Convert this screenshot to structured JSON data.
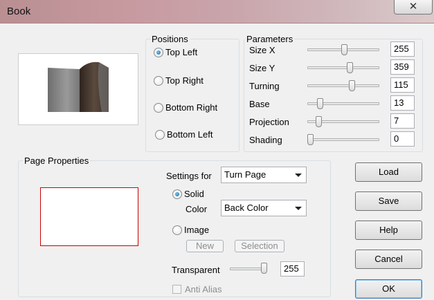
{
  "window": {
    "title": "Book",
    "close_glyph": "✕"
  },
  "positions": {
    "legend": "Positions",
    "options": [
      {
        "label": "Top Left",
        "checked": true
      },
      {
        "label": "Top Right",
        "checked": false
      },
      {
        "label": "Bottom Right",
        "checked": false
      },
      {
        "label": "Bottom Left",
        "checked": false
      }
    ]
  },
  "parameters": {
    "legend": "Parameters",
    "rows": [
      {
        "label": "Size X",
        "value": "255",
        "level": 0.52
      },
      {
        "label": "Size Y",
        "value": "359",
        "level": 0.6
      },
      {
        "label": "Turning",
        "value": "115",
        "level": 0.63
      },
      {
        "label": "Base",
        "value": "13",
        "level": 0.15
      },
      {
        "label": "Projection",
        "value": "7",
        "level": 0.13
      },
      {
        "label": "Shading",
        "value": "0",
        "level": 0.0
      }
    ]
  },
  "page_properties": {
    "legend": "Page Properties",
    "settings_for_label": "Settings for",
    "settings_for_value": "Turn Page",
    "solid_label": "Solid",
    "color_label": "Color",
    "color_value": "Back Color",
    "image_label": "Image",
    "new_label": "New",
    "selection_label": "Selection",
    "transparent_label": "Transparent",
    "transparent_value": "255",
    "transparent_level": 1.0,
    "anti_alias_label": "Anti Alias"
  },
  "buttons": {
    "load": "Load",
    "save": "Save",
    "help": "Help",
    "cancel": "Cancel",
    "ok": "OK"
  },
  "colors": {
    "preview_border": "#cc0000",
    "book_left": "#808080",
    "book_right": "#4a3a30"
  }
}
